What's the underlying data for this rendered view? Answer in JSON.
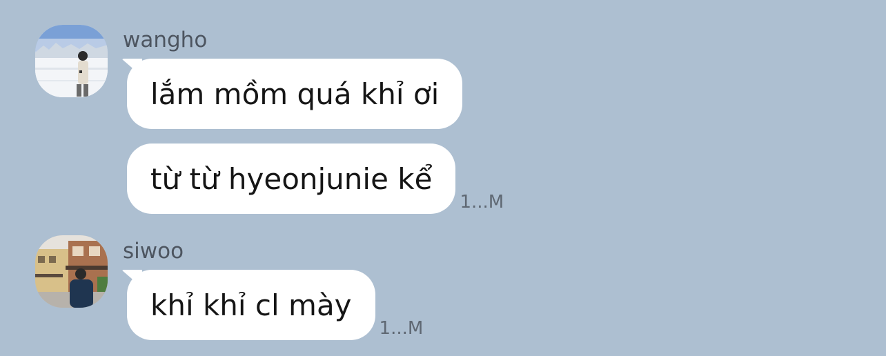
{
  "groups": [
    {
      "sender": "wangho",
      "messages": [
        {
          "text": "lắm mồm quá khỉ ơi",
          "meta": ""
        },
        {
          "text": "từ từ hyeonjunie kể",
          "meta": "1...M"
        }
      ]
    },
    {
      "sender": "siwoo",
      "messages": [
        {
          "text": "khỉ khỉ cl mày",
          "meta": "1...M"
        }
      ]
    }
  ],
  "colors": {
    "background": "#adbfd1",
    "bubble": "#ffffff",
    "name_text": "#4d5560",
    "meta_text": "#5f6873"
  }
}
